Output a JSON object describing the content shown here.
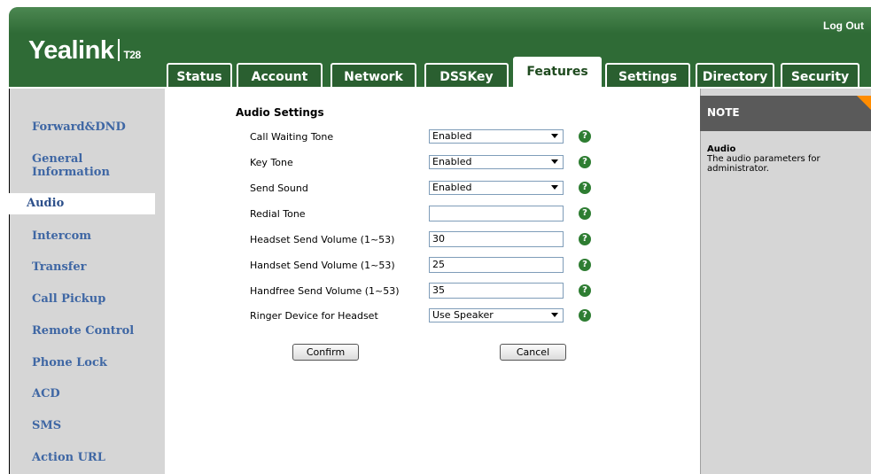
{
  "brand": {
    "name": "Yealink",
    "model": "T28"
  },
  "header": {
    "logout_label": "Log Out"
  },
  "tabs": [
    {
      "label": "Status",
      "active": false
    },
    {
      "label": "Account",
      "active": false
    },
    {
      "label": "Network",
      "active": false
    },
    {
      "label": "DSSKey",
      "active": false
    },
    {
      "label": "Features",
      "active": true
    },
    {
      "label": "Settings",
      "active": false
    },
    {
      "label": "Directory",
      "active": false
    },
    {
      "label": "Security",
      "active": false
    }
  ],
  "sidebar": {
    "items": [
      {
        "label": "Forward&DND"
      },
      {
        "label": "General Information"
      },
      {
        "label": "Audio",
        "active": true
      },
      {
        "label": "Intercom"
      },
      {
        "label": "Transfer"
      },
      {
        "label": "Call Pickup"
      },
      {
        "label": "Remote Control"
      },
      {
        "label": "Phone Lock"
      },
      {
        "label": "ACD"
      },
      {
        "label": "SMS"
      },
      {
        "label": "Action URL"
      }
    ]
  },
  "main": {
    "heading": "Audio Settings",
    "fields": [
      {
        "label": "Call Waiting Tone",
        "type": "select",
        "value": "Enabled"
      },
      {
        "label": "Key Tone",
        "type": "select",
        "value": "Enabled"
      },
      {
        "label": "Send Sound",
        "type": "select",
        "value": "Enabled"
      },
      {
        "label": "Redial Tone",
        "type": "input",
        "value": ""
      },
      {
        "label": "Headset Send Volume (1~53)",
        "type": "input",
        "value": "30"
      },
      {
        "label": "Handset Send Volume (1~53)",
        "type": "input",
        "value": "25"
      },
      {
        "label": "Handfree Send Volume (1~53)",
        "type": "input",
        "value": "35"
      },
      {
        "label": "Ringer Device for Headset",
        "type": "select",
        "value": "Use Speaker"
      }
    ],
    "help_glyph": "?",
    "confirm_label": "Confirm",
    "cancel_label": "Cancel"
  },
  "note": {
    "title": "NOTE",
    "topic": "Audio",
    "text": "The audio parameters for administrator."
  },
  "colors": {
    "header_green": "#2f6b36",
    "nav_link": "#3f67a4",
    "help_green": "#2e7d32",
    "note_corner": "#ff8c00"
  }
}
